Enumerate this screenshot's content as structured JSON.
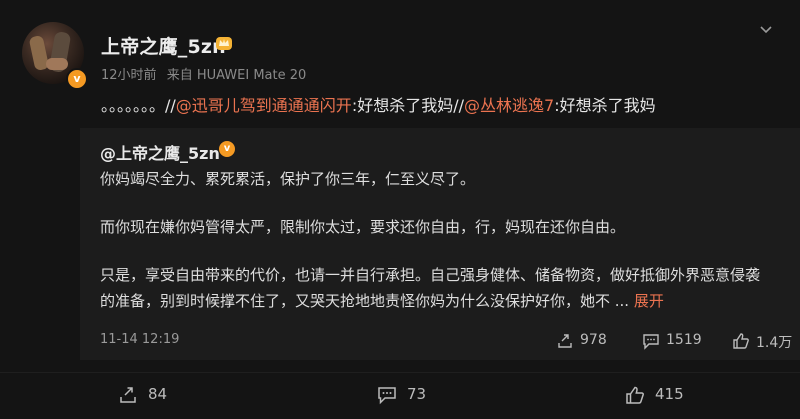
{
  "post": {
    "username": "上帝之鹰_5zn",
    "verified_mark": "v",
    "time": "12小时前",
    "source": "来自 HUAWEI Mate 20",
    "repost": {
      "dots": "。。。。。。。//",
      "mention1": "@迅哥儿驾到通通通闪开",
      "text1": ":好想杀了我妈//",
      "mention2": "@丛林逃逸7",
      "text2": ":好想杀了我妈"
    }
  },
  "quote": {
    "username": "@上帝之鹰_5zn",
    "verified_mark": "v",
    "lines": [
      "你妈竭尽全力、累死累活，保护了你三年，仁至义尽了。",
      "而你现在嫌你妈管得太严，限制你太过，要求还你自由，行，妈现在还你自由。",
      "只是，享受自由带来的代价，也请一并自行承担。自己强身健体、储备物资，做好抵御外界恶意侵袭",
      "的准备，别到时候撑不住了，又哭天抢地地责怪你妈为什么没保护好你，她不  ... "
    ],
    "expand_label": "展开",
    "time": "11-14 12:19",
    "reposts": "978",
    "comments": "1519",
    "likes": "1.4万"
  },
  "actions": {
    "reposts": "84",
    "comments": "73",
    "likes": "415"
  },
  "colors": {
    "accent": "#eb7350",
    "badge": "#f59a23",
    "background": "#141414",
    "quote_background": "#1c1c1c"
  }
}
